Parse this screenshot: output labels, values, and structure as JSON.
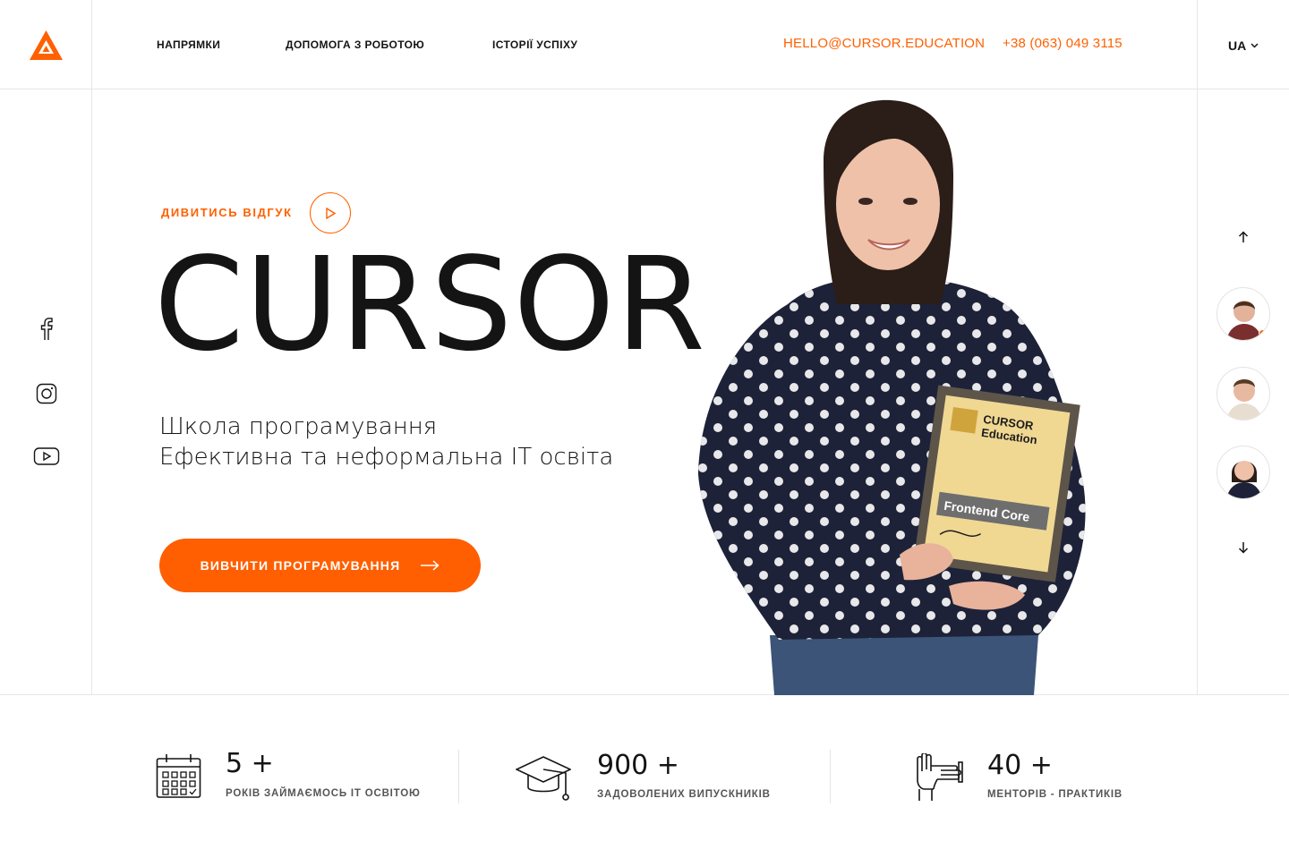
{
  "header": {
    "nav": [
      "Напрямки",
      "Допомога з роботою",
      "Історії успіху"
    ],
    "email": "HELLO@CURSOR.EDUCATION",
    "phone": "+38 (063) 049 3115",
    "language": "UA"
  },
  "social": {
    "icons": [
      "facebook-icon",
      "instagram-icon",
      "youtube-icon"
    ]
  },
  "hero": {
    "review_label": "Дивитись відгук",
    "brand": "CURSOR",
    "subtitle_line1": "Школа програмування",
    "subtitle_line2": "Ефективна та неформальна ІТ освіта",
    "cta_label": "Вивчити програмування",
    "certificate_title": "CURSOR Education",
    "certificate_course": "Frontend Core"
  },
  "stats": [
    {
      "value": "5 +",
      "label": "років займаємось IT освітою",
      "icon": "calendar-icon"
    },
    {
      "value": "900 +",
      "label": "задоволених випускників",
      "icon": "graduation-cap-icon"
    },
    {
      "value": "40 +",
      "label": "менторів - практиків",
      "icon": "handshake-icon"
    }
  ],
  "colors": {
    "accent": "#ff6000",
    "text": "#141414",
    "border": "#e6e6e6"
  }
}
